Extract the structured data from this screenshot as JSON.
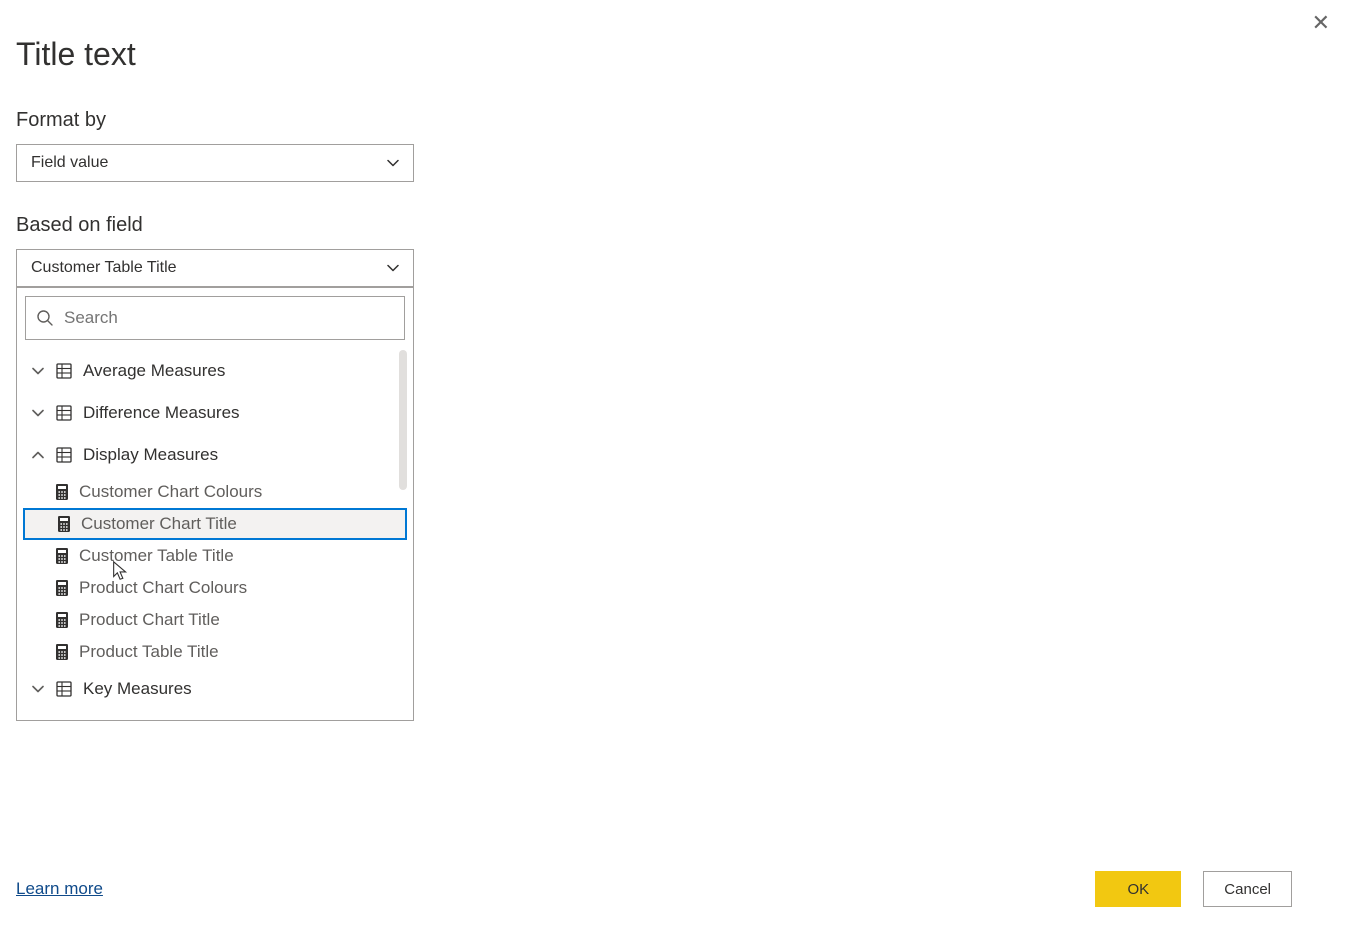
{
  "title": "Title text",
  "format_by": {
    "label": "Format by",
    "value": "Field value"
  },
  "based_on": {
    "label": "Based on field",
    "value": "Customer Table Title"
  },
  "search": {
    "placeholder": "Search"
  },
  "groups": [
    {
      "label": "Average Measures",
      "expanded": false,
      "items": []
    },
    {
      "label": "Difference Measures",
      "expanded": false,
      "items": []
    },
    {
      "label": "Display Measures",
      "expanded": true,
      "items": [
        {
          "label": "Customer Chart Colours",
          "selected": false
        },
        {
          "label": "Customer Chart Title",
          "selected": true
        },
        {
          "label": "Customer Table Title",
          "selected": false
        },
        {
          "label": "Product Chart Colours",
          "selected": false
        },
        {
          "label": "Product Chart Title",
          "selected": false
        },
        {
          "label": "Product Table Title",
          "selected": false
        }
      ]
    },
    {
      "label": "Key Measures",
      "expanded": false,
      "items": []
    }
  ],
  "footer": {
    "learn_more": "Learn more",
    "ok": "OK",
    "cancel": "Cancel"
  }
}
